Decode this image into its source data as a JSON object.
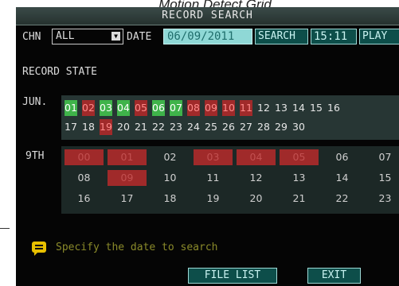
{
  "caption": "Motion Detect Grid",
  "window": {
    "title": "RECORD SEARCH"
  },
  "controls": {
    "chn_label": "CHN",
    "chn_value": "ALL",
    "date_label": "DATE",
    "date_value": "06/09/2011",
    "search_label": "SEARCH",
    "time_value": "15:11",
    "play_label": "PLAY"
  },
  "record_state_label": "RECORD STATE",
  "month_label": "JUN.",
  "colors": {
    "green": "#3fb34a",
    "red": "#a02a2a",
    "white": "#e6e6e6",
    "hint": "#8a8a2a"
  },
  "days": [
    {
      "label": "01",
      "state": "green"
    },
    {
      "label": "02",
      "state": "red"
    },
    {
      "label": "03",
      "state": "green"
    },
    {
      "label": "04",
      "state": "green"
    },
    {
      "label": "05",
      "state": "red"
    },
    {
      "label": "06",
      "state": "green"
    },
    {
      "label": "07",
      "state": "green"
    },
    {
      "label": "08",
      "state": "red"
    },
    {
      "label": "09",
      "state": "red"
    },
    {
      "label": "10",
      "state": "red"
    },
    {
      "label": "11",
      "state": "red"
    },
    {
      "label": "12",
      "state": "none"
    },
    {
      "label": "13",
      "state": "none"
    },
    {
      "label": "14",
      "state": "none"
    },
    {
      "label": "15",
      "state": "none"
    },
    {
      "label": "16",
      "state": "none"
    },
    {
      "label": "17",
      "state": "none"
    },
    {
      "label": "18",
      "state": "none"
    },
    {
      "label": "19",
      "state": "red"
    },
    {
      "label": "20",
      "state": "none"
    },
    {
      "label": "21",
      "state": "none"
    },
    {
      "label": "22",
      "state": "none"
    },
    {
      "label": "23",
      "state": "none"
    },
    {
      "label": "24",
      "state": "none"
    },
    {
      "label": "25",
      "state": "none"
    },
    {
      "label": "26",
      "state": "none"
    },
    {
      "label": "27",
      "state": "none"
    },
    {
      "label": "28",
      "state": "none"
    },
    {
      "label": "29",
      "state": "none"
    },
    {
      "label": "30",
      "state": "none"
    }
  ],
  "selected_day_label": "9TH",
  "hours": [
    {
      "label": "00",
      "state": "red"
    },
    {
      "label": "01",
      "state": "red"
    },
    {
      "label": "02",
      "state": "none"
    },
    {
      "label": "03",
      "state": "red"
    },
    {
      "label": "04",
      "state": "red"
    },
    {
      "label": "05",
      "state": "red"
    },
    {
      "label": "06",
      "state": "none"
    },
    {
      "label": "07",
      "state": "none"
    },
    {
      "label": "08",
      "state": "none"
    },
    {
      "label": "09",
      "state": "red"
    },
    {
      "label": "10",
      "state": "none"
    },
    {
      "label": "11",
      "state": "none"
    },
    {
      "label": "12",
      "state": "none"
    },
    {
      "label": "13",
      "state": "none"
    },
    {
      "label": "14",
      "state": "none"
    },
    {
      "label": "15",
      "state": "none"
    },
    {
      "label": "16",
      "state": "none"
    },
    {
      "label": "17",
      "state": "none"
    },
    {
      "label": "18",
      "state": "none"
    },
    {
      "label": "19",
      "state": "none"
    },
    {
      "label": "20",
      "state": "none"
    },
    {
      "label": "21",
      "state": "none"
    },
    {
      "label": "22",
      "state": "none"
    },
    {
      "label": "23",
      "state": "none"
    }
  ],
  "hint": "Specify the date to search",
  "buttons": {
    "file_list": "FILE LIST",
    "exit": "EXIT"
  }
}
